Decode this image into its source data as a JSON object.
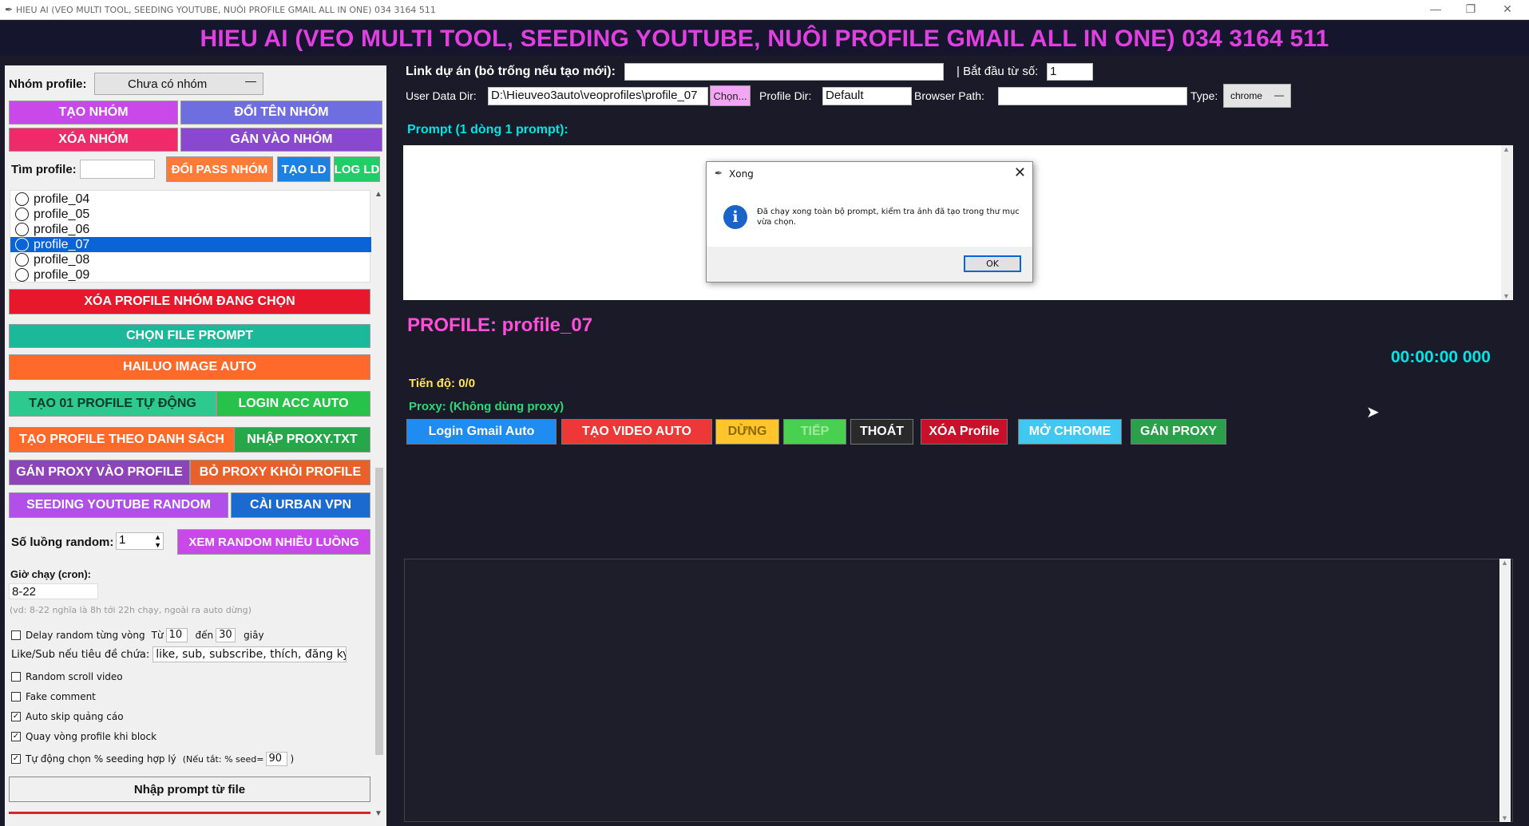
{
  "window": {
    "title": "HIEU AI (VEO MULTI TOOL, SEEDING YOUTUBE, NUÔI PROFILE GMAIL ALL IN ONE) 034 3164 511",
    "minimize": "—",
    "maximize": "❐",
    "close": "✕"
  },
  "header": {
    "title": "HIEU AI (VEO MULTI TOOL, SEEDING YOUTUBE, NUÔI PROFILE GMAIL ALL IN ONE) 034 3164 511"
  },
  "left": {
    "group_label": "Nhóm profile:",
    "group_value": "Chưa có nhóm",
    "btn_create_group": "TẠO NHÓM",
    "btn_rename_group": "ĐỔI TÊN NHÓM",
    "btn_delete_group": "XÓA NHÓM",
    "btn_assign_group": "GÁN VÀO NHÓM",
    "search_label": "Tìm profile:",
    "search_value": "",
    "btn_change_pass": "ĐỔI PASS NHÓM",
    "btn_create_ld": "TẠO LD",
    "btn_log_ld": "LOG LD",
    "profiles": [
      {
        "name": "profile_04",
        "selected": false
      },
      {
        "name": "profile_05",
        "selected": false
      },
      {
        "name": "profile_06",
        "selected": false
      },
      {
        "name": "profile_07",
        "selected": true
      },
      {
        "name": "profile_08",
        "selected": false
      },
      {
        "name": "profile_09",
        "selected": false
      }
    ],
    "btn_delete_profile": "XÓA PROFILE NHÓM ĐANG CHỌN",
    "btn_choose_prompt": "CHỌN FILE PROMPT",
    "btn_hailuo": "HAILUO IMAGE AUTO",
    "btn_create_01": "TẠO 01 PROFILE TỰ ĐỘNG",
    "btn_login_acc": "LOGIN ACC AUTO",
    "btn_create_list": "TẠO PROFILE THEO DANH SÁCH",
    "btn_import_proxy": "NHẬP PROXY.TXT",
    "btn_assign_proxy": "GÁN PROXY VÀO PROFILE",
    "btn_remove_proxy": "BỎ PROXY KHỎI PROFILE",
    "btn_seeding": "SEEDING YOUTUBE RANDOM",
    "btn_urban": "CÀI URBAN VPN",
    "threads_label": "Số luồng random:",
    "threads_value": "1",
    "btn_view_random": "XEM RANDOM NHIỀU LUỒNG",
    "cron_label": "Giờ chạy (cron):",
    "cron_value": "8-22",
    "cron_hint": "(vd: 8-22 nghĩa là 8h tới 22h chạy, ngoài ra auto dừng)",
    "delay_label": "Delay random từng vòng",
    "delay_from_label": "Từ",
    "delay_from": "10",
    "delay_to_label": "đến",
    "delay_to": "30",
    "delay_unit": "giây",
    "likesub_label": "Like/Sub nếu tiêu đề chứa:",
    "likesub_value": "like, sub, subscribe, thích, đăng ký",
    "opt_random_scroll": "Random scroll video",
    "opt_fake_comment": "Fake comment",
    "opt_auto_skip": "Auto skip quảng cáo",
    "opt_rotate": "Quay vòng profile khi block",
    "opt_auto_percent": "Tự động chọn % seeding hợp lý",
    "percent_hint": "(Nếu tắt: % seed=",
    "percent_value": "90",
    "percent_close": ")",
    "btn_import_prompt": "Nhập prompt từ file",
    "checks": {
      "delay": "",
      "random_scroll": "",
      "fake_comment": "",
      "auto_skip": "✓",
      "rotate": "✓",
      "auto_percent": "✓"
    }
  },
  "right": {
    "link_label": "Link dự án (bỏ trống nếu tạo mới):",
    "link_value": "",
    "start_label": "| Bắt đầu từ số:",
    "start_value": "1",
    "userdata_label": "User Data Dir:",
    "userdata_value": "D:\\Hieuveo3auto\\veoprofiles\\profile_07",
    "btn_choose": "Chọn...",
    "profiledir_label": "Profile Dir:",
    "profiledir_value": "Default",
    "browser_label": "Browser Path:",
    "browser_value": "",
    "type_label": "Type:",
    "type_value": "chrome",
    "prompt_label": "Prompt (1 dòng 1 prompt):",
    "profile_title": "PROFILE: profile_07",
    "timer": "00:00:00 000",
    "progress": "Tiến độ: 0/0",
    "proxy": "Proxy: (Không dùng proxy)",
    "buttons": {
      "login_gmail": "Login Gmail Auto",
      "create_video": "TẠO VIDEO AUTO",
      "stop": "DỪNG",
      "next": "TIẾP",
      "exit": "THOÁT",
      "delete_profile": "XÓA Profile",
      "open_chrome": "MỞ CHROME",
      "assign_proxy": "GÁN PROXY"
    }
  },
  "dialog": {
    "title": "Xong",
    "message": "Đã chạy xong toàn bộ prompt, kiểm tra ảnh đã tạo trong thư mục vừa chọn.",
    "ok": "OK",
    "info_glyph": "i",
    "close_glyph": "✕"
  },
  "colors": {
    "header_text": "#e040e0",
    "accent_cyan": "#00e5e5",
    "profile_title": "#ff4fd8"
  }
}
